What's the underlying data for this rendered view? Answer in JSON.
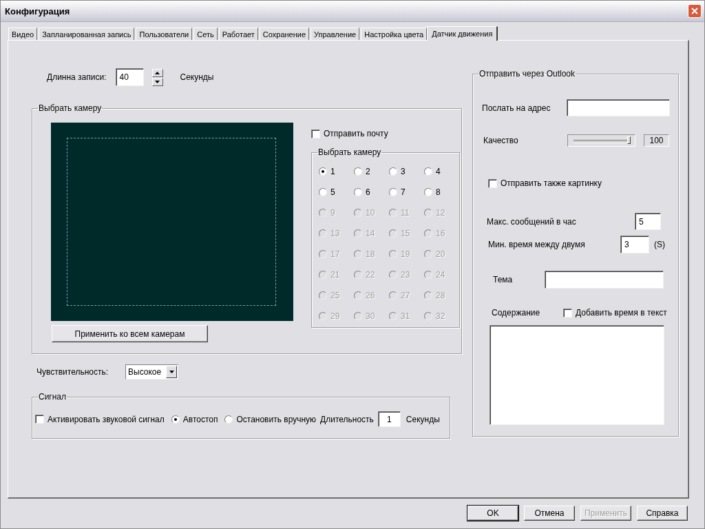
{
  "window": {
    "title": "Конфигурация"
  },
  "tabs": [
    {
      "label": "Видео",
      "selected": false
    },
    {
      "label": "Запланированная запись",
      "selected": false
    },
    {
      "label": "Пользователи",
      "selected": false
    },
    {
      "label": "Сеть",
      "selected": false
    },
    {
      "label": "Работает",
      "selected": false
    },
    {
      "label": "Сохранение",
      "selected": false
    },
    {
      "label": "Управление",
      "selected": false
    },
    {
      "label": "Настройка цвета",
      "selected": false
    },
    {
      "label": "Датчик движения",
      "selected": true
    }
  ],
  "record_length": {
    "label": "Длинна записи:",
    "value": "40",
    "unit": "Секунды"
  },
  "camera_group": {
    "title": "Выбрать камеру",
    "apply_button": "Применить ко всем камерам",
    "send_mail": {
      "label": "Отправить почту",
      "checked": false
    },
    "camera_select": {
      "title": "Выбрать камеру",
      "cameras": [
        {
          "label": "1",
          "selected": true,
          "disabled": false
        },
        {
          "label": "2",
          "selected": false,
          "disabled": false
        },
        {
          "label": "3",
          "selected": false,
          "disabled": false
        },
        {
          "label": "4",
          "selected": false,
          "disabled": false
        },
        {
          "label": "5",
          "selected": false,
          "disabled": false
        },
        {
          "label": "6",
          "selected": false,
          "disabled": false
        },
        {
          "label": "7",
          "selected": false,
          "disabled": false
        },
        {
          "label": "8",
          "selected": false,
          "disabled": false
        },
        {
          "label": "9",
          "selected": false,
          "disabled": true
        },
        {
          "label": "10",
          "selected": false,
          "disabled": true
        },
        {
          "label": "11",
          "selected": false,
          "disabled": true
        },
        {
          "label": "12",
          "selected": false,
          "disabled": true
        },
        {
          "label": "13",
          "selected": false,
          "disabled": true
        },
        {
          "label": "14",
          "selected": false,
          "disabled": true
        },
        {
          "label": "15",
          "selected": false,
          "disabled": true
        },
        {
          "label": "16",
          "selected": false,
          "disabled": true
        },
        {
          "label": "17",
          "selected": false,
          "disabled": true
        },
        {
          "label": "18",
          "selected": false,
          "disabled": true
        },
        {
          "label": "19",
          "selected": false,
          "disabled": true
        },
        {
          "label": "20",
          "selected": false,
          "disabled": true
        },
        {
          "label": "21",
          "selected": false,
          "disabled": true
        },
        {
          "label": "22",
          "selected": false,
          "disabled": true
        },
        {
          "label": "23",
          "selected": false,
          "disabled": true
        },
        {
          "label": "24",
          "selected": false,
          "disabled": true
        },
        {
          "label": "25",
          "selected": false,
          "disabled": true
        },
        {
          "label": "26",
          "selected": false,
          "disabled": true
        },
        {
          "label": "27",
          "selected": false,
          "disabled": true
        },
        {
          "label": "28",
          "selected": false,
          "disabled": true
        },
        {
          "label": "29",
          "selected": false,
          "disabled": true
        },
        {
          "label": "30",
          "selected": false,
          "disabled": true
        },
        {
          "label": "31",
          "selected": false,
          "disabled": true
        },
        {
          "label": "32",
          "selected": false,
          "disabled": true
        }
      ]
    }
  },
  "sensitivity": {
    "label": "Чувствительность:",
    "value": "Высокое"
  },
  "signal": {
    "title": "Сигнал",
    "activate": {
      "label": "Активировать звуковой сигнал",
      "checked": false
    },
    "modes": [
      {
        "label": "Автостоп",
        "selected": true
      },
      {
        "label": "Остановить вручную",
        "selected": false
      }
    ],
    "duration_label": "Длительность",
    "duration": "1",
    "unit": "Секунды"
  },
  "outlook": {
    "title": "Отправить через Outlook",
    "address_label": "Послать на адрес",
    "quality_label": "Качество",
    "quality": {
      "level": 1
    },
    "quality_reading": "100",
    "send_picture": {
      "label": "Отправить также картинку",
      "checked": false
    },
    "max_messages_label": "Макс. сообщений в час",
    "max_messages": "5",
    "min_time_label": "Мин. время между двумя",
    "min_time": "3",
    "min_time_unit": "(S)",
    "subject_label": "Тема",
    "content_label": "Содержание",
    "add_time": {
      "label": "Добавить время в текст",
      "checked": false
    }
  },
  "buttons": [
    {
      "label": "OK",
      "default": true,
      "disabled": false
    },
    {
      "label": "Отмена",
      "default": false,
      "disabled": false
    },
    {
      "label": "Применить",
      "default": false,
      "disabled": true
    },
    {
      "label": "Справка",
      "default": false,
      "disabled": false
    }
  ]
}
